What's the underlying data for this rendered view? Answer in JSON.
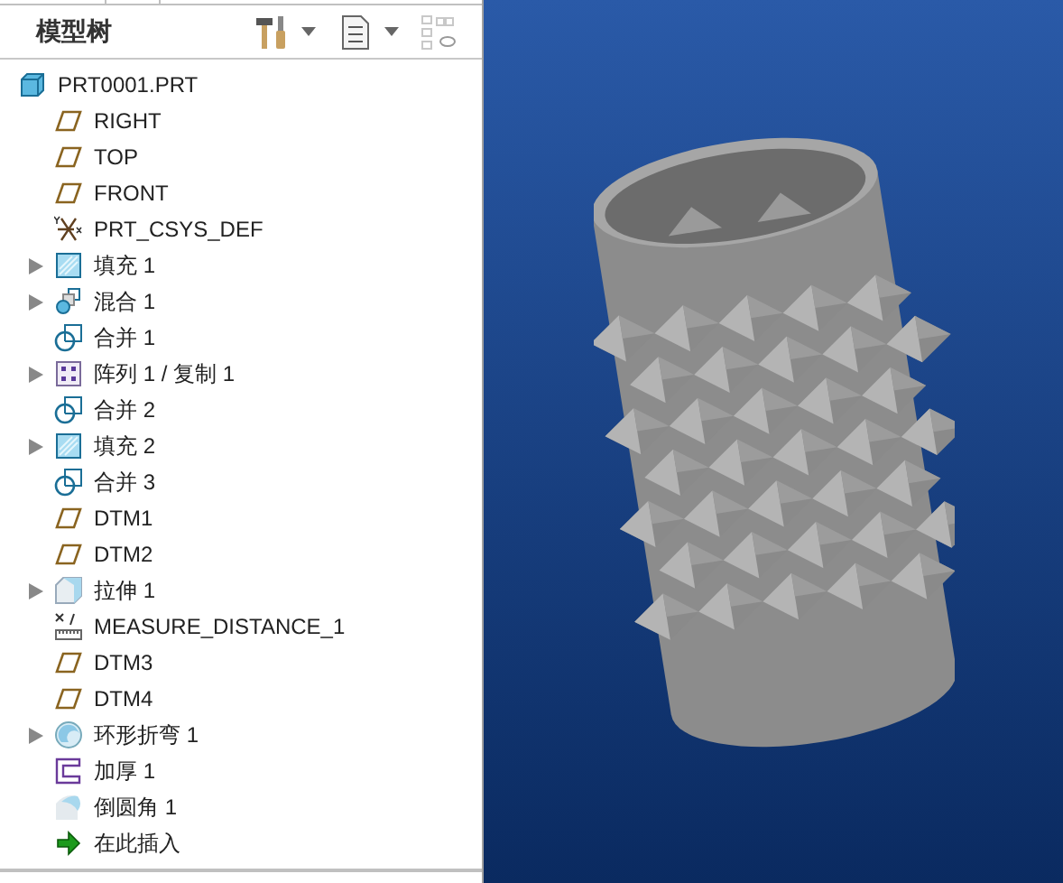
{
  "panel": {
    "title": "模型树"
  },
  "tree": [
    {
      "label": "PRT0001.PRT",
      "kind": "part",
      "expandable": false
    },
    {
      "label": "RIGHT",
      "kind": "plane",
      "expandable": false
    },
    {
      "label": "TOP",
      "kind": "plane",
      "expandable": false
    },
    {
      "label": "FRONT",
      "kind": "plane",
      "expandable": false
    },
    {
      "label": "PRT_CSYS_DEF",
      "kind": "csys",
      "expandable": false
    },
    {
      "label": "填充 1",
      "kind": "fill",
      "expandable": true
    },
    {
      "label": "混合 1",
      "kind": "blend",
      "expandable": true
    },
    {
      "label": "合并 1",
      "kind": "merge",
      "expandable": false
    },
    {
      "label": "阵列 1 / 复制 1",
      "kind": "pattern",
      "expandable": true
    },
    {
      "label": "合并 2",
      "kind": "merge",
      "expandable": false
    },
    {
      "label": "填充 2",
      "kind": "fill",
      "expandable": true
    },
    {
      "label": "合并 3",
      "kind": "merge",
      "expandable": false
    },
    {
      "label": "DTM1",
      "kind": "plane",
      "expandable": false
    },
    {
      "label": "DTM2",
      "kind": "plane",
      "expandable": false
    },
    {
      "label": "拉伸 1",
      "kind": "extrude",
      "expandable": true
    },
    {
      "label": "MEASURE_DISTANCE_1",
      "kind": "measure",
      "expandable": false
    },
    {
      "label": "DTM3",
      "kind": "plane",
      "expandable": false
    },
    {
      "label": "DTM4",
      "kind": "plane",
      "expandable": false
    },
    {
      "label": "环形折弯 1",
      "kind": "bend",
      "expandable": true
    },
    {
      "label": "加厚 1",
      "kind": "thicken",
      "expandable": false
    },
    {
      "label": "倒圆角 1",
      "kind": "round",
      "expandable": false
    },
    {
      "label": "在此插入",
      "kind": "insert",
      "expandable": false
    }
  ]
}
